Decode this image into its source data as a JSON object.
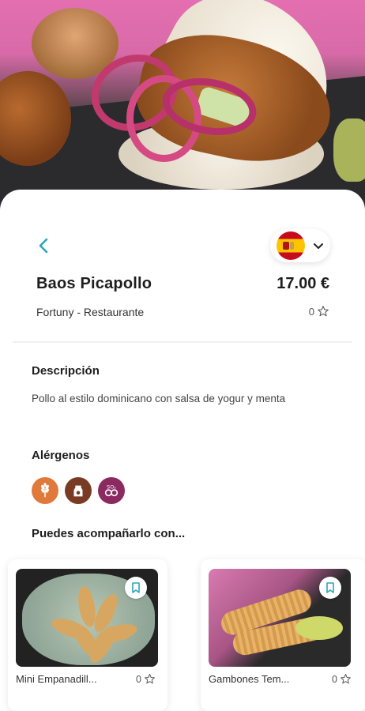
{
  "dish": {
    "name": "Baos Picapollo",
    "price": "17.00 €",
    "venue": "Fortuny - Restaurante",
    "rating": "0"
  },
  "language": {
    "flag": "spain-flag",
    "selected": "Español"
  },
  "description": {
    "heading": "Descripción",
    "text": "Pollo al estilo dominicano con salsa de yogur y menta"
  },
  "allergens": {
    "heading": "Alérgenos",
    "items": [
      {
        "icon": "gluten-icon",
        "color": "#e07a3a"
      },
      {
        "icon": "dairy-icon",
        "color": "#7a3b25"
      },
      {
        "icon": "sulphites-icon",
        "color": "#8b2a61"
      }
    ]
  },
  "suggestions": {
    "heading": "Puedes acompañarlo con...",
    "items": [
      {
        "name": "Mini Empanadill...",
        "rating": "0"
      },
      {
        "name": "Gambones Tem...",
        "rating": "0"
      }
    ]
  },
  "colors": {
    "accent": "#2aa7b5",
    "text": "#1e1e1e"
  }
}
